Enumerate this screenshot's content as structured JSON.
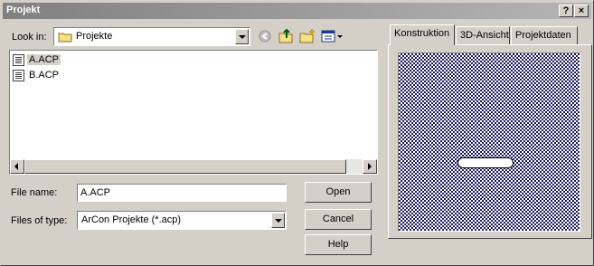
{
  "window": {
    "title": "Projekt",
    "help_button": "?",
    "close_button": "×"
  },
  "look_in": {
    "label": "Look in:",
    "value": "Projekte"
  },
  "toolbar": {
    "back_icon": "back-arrow-icon",
    "up_icon": "up-folder-icon",
    "new_folder_icon": "new-folder-icon",
    "view_icon": "view-menu-icon"
  },
  "files": [
    {
      "name": "A.ACP",
      "selected": true
    },
    {
      "name": "B.ACP",
      "selected": false
    }
  ],
  "file_name": {
    "label": "File name:",
    "value": "A.ACP"
  },
  "file_type": {
    "label": "Files of type:",
    "value": "ArCon Projekte (*.acp)"
  },
  "buttons": {
    "open": "Open",
    "cancel": "Cancel",
    "help": "Help"
  },
  "tabs": [
    {
      "label": "Konstruktion",
      "active": true
    },
    {
      "label": "3D-Ansicht",
      "active": false
    },
    {
      "label": "Projektdaten",
      "active": false
    }
  ],
  "colors": {
    "preview_pattern": "#1a1a66",
    "face": "#d4d0c8"
  }
}
